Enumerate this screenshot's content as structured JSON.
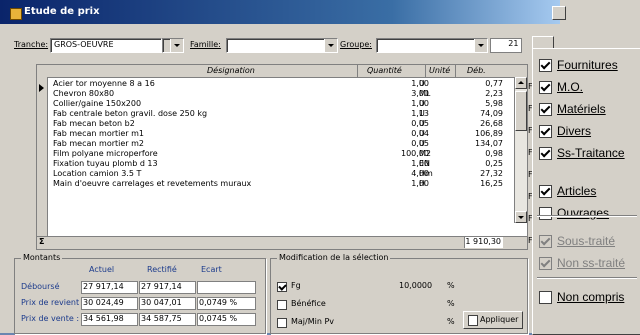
{
  "window": {
    "title": "Etude de prix"
  },
  "filters": {
    "tranche_label": "Tranche:",
    "tranche_value": "GROS-OEUVRE",
    "famille_label": "Famille:",
    "famille_value": "",
    "groupe_label": "Groupe:",
    "groupe_value": "",
    "page_value": "21"
  },
  "grid": {
    "headers": {
      "designation": "Désignation",
      "quantite": "Quantité",
      "unite": "Unité",
      "deb": "Déb."
    },
    "rows": [
      {
        "designation": "Acier tor moyenne 8 a 16",
        "quantite": "1,00",
        "unite": "U",
        "deb": "0,77"
      },
      {
        "designation": "Chevron 80x80",
        "quantite": "3,00",
        "unite": "ML",
        "deb": "2,23"
      },
      {
        "designation": "Collier/gaine 150x200",
        "quantite": "1,00",
        "unite": "U",
        "deb": "5,98"
      },
      {
        "designation": "Fab centrale beton gravil. dose 250 kg",
        "quantite": "1,13",
        "unite": "U",
        "deb": "74,09"
      },
      {
        "designation": "Fab mecan beton b2",
        "quantite": "0,05",
        "unite": "U",
        "deb": "26,68"
      },
      {
        "designation": "Fab mecan mortier m1",
        "quantite": "0,04",
        "unite": "U",
        "deb": "106,89"
      },
      {
        "designation": "Fab mecan mortier m2",
        "quantite": "0,05",
        "unite": "U",
        "deb": "134,07"
      },
      {
        "designation": "Film polyane microperfore",
        "quantite": "100,00",
        "unite": "M2",
        "deb": "0,98"
      },
      {
        "designation": "Fixation tuyau plomb d 13",
        "quantite": "1,00",
        "unite": "EN",
        "deb": "0,25"
      },
      {
        "designation": "Location camion 3.5 T",
        "quantite": "4,00",
        "unite": "Hm",
        "deb": "27,32"
      },
      {
        "designation": "Main d'oeuvre carrelages et revetements muraux",
        "quantite": "1,00",
        "unite": "H",
        "deb": "16,25"
      }
    ],
    "total_symbol": "Σ",
    "total_value": "1 910,30"
  },
  "montants": {
    "title": "Montants",
    "col_actuel": "Actuel",
    "col_rectifie": "Rectifié",
    "col_ecart": "Ecart",
    "rows": [
      {
        "label": "Déboursé",
        "actuel": "27 917,14",
        "rectifie": "27 917,14",
        "ecart": ""
      },
      {
        "label": "Prix de revient :",
        "actuel": "30 024,49",
        "rectifie": "30 047,01",
        "ecart": "0,0749 %"
      },
      {
        "label": "Prix de vente :",
        "actuel": "34 561,98",
        "rectifie": "34 587,75",
        "ecart": "0,0745 %"
      }
    ]
  },
  "modification": {
    "title": "Modification de la sélection",
    "fg_label": "Fg",
    "fg_value": "10,0000",
    "fg_unit": "%",
    "benefice_label": "Bénéfice",
    "benefice_unit": "%",
    "majmin_label": "Maj/Min Pv",
    "majmin_unit": "%",
    "apply_label": "Appliquer"
  },
  "side_letters": [
    "F",
    "F",
    "F",
    "F",
    "F",
    "F",
    "F",
    "F"
  ],
  "menu": {
    "items": [
      {
        "label": "Fournitures",
        "checked": true,
        "disabled": false
      },
      {
        "label": "M.O.",
        "checked": true,
        "disabled": false
      },
      {
        "label": "Matériels",
        "checked": true,
        "disabled": false
      },
      {
        "label": "Divers",
        "checked": true,
        "disabled": false
      },
      {
        "label": "Ss-Traitance",
        "checked": true,
        "disabled": false
      },
      {
        "label": "Articles",
        "checked": true,
        "disabled": false
      },
      {
        "label": "Ouvrages",
        "checked": false,
        "disabled": false
      },
      {
        "label": "Sous-traité",
        "checked": true,
        "disabled": true
      },
      {
        "label": "Non ss-traité",
        "checked": true,
        "disabled": true
      },
      {
        "label": "Non compris",
        "checked": false,
        "disabled": false
      }
    ]
  }
}
